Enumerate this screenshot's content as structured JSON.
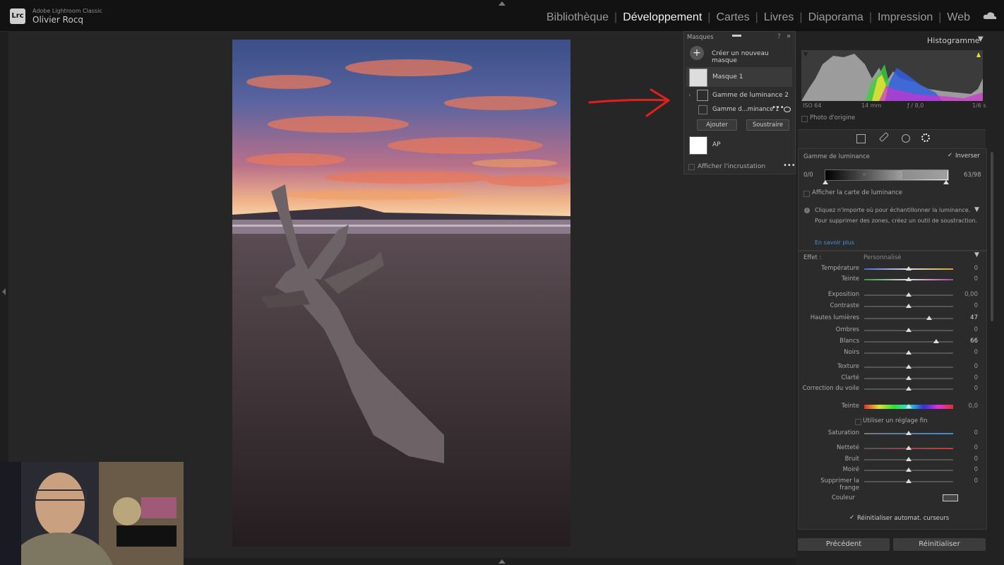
{
  "app": {
    "logo": "Lrc",
    "name": "Adobe Lightroom Classic",
    "user": "Olivier Rocq"
  },
  "modules": [
    "Bibliothèque",
    "Développement",
    "Cartes",
    "Livres",
    "Diaporama",
    "Impression",
    "Web"
  ],
  "active_module": "Développement",
  "masks": {
    "title": "Masques",
    "new_mask": "Créer un nouveau masque",
    "mask1": "Masque 1",
    "lum2": "Gamme de luminance 2",
    "lum1": "Gamme d...minance 1",
    "add": "Ajouter",
    "subtract": "Soustraire",
    "ap": "AP",
    "overlay": "Afficher l'incrustation"
  },
  "histogram": {
    "title": "Histogramme",
    "iso": "ISO 64",
    "focal": "14 mm",
    "aperture": "ƒ / 8,0",
    "shutter": "1/6 s",
    "original": "Photo d'origine"
  },
  "luminance": {
    "title": "Gamme de luminance",
    "invert": "Inverser",
    "left_val": "0/0",
    "right_val": "63/98",
    "show_map": "Afficher la carte de luminance",
    "info1": "Cliquez n'importe où pour échantillonner la luminance.",
    "info2": "Pour supprimer des zones, créez un outil de soustraction.",
    "learn_more": "En savoir plus"
  },
  "effect": {
    "label": "Effet :",
    "preset": "Personnalisé"
  },
  "sliders": [
    {
      "name": "Température",
      "value": "0",
      "pos": 0.5
    },
    {
      "name": "Teinte",
      "value": "0",
      "pos": 0.5
    },
    {
      "name": "Exposition",
      "value": "0,00",
      "pos": 0.5
    },
    {
      "name": "Contraste",
      "value": "0",
      "pos": 0.5
    },
    {
      "name": "Hautes lumières",
      "value": "47",
      "pos": 0.73
    },
    {
      "name": "Ombres",
      "value": "0",
      "pos": 0.5
    },
    {
      "name": "Blancs",
      "value": "66",
      "pos": 0.81
    },
    {
      "name": "Noirs",
      "value": "0",
      "pos": 0.5
    },
    {
      "name": "Texture",
      "value": "0",
      "pos": 0.5
    },
    {
      "name": "Clarté",
      "value": "0",
      "pos": 0.5
    },
    {
      "name": "Correction du voile",
      "value": "0",
      "pos": 0.5
    },
    {
      "name": "Teinte",
      "value": "0,0",
      "pos": 0.5
    },
    {
      "name": "Saturation",
      "value": "0",
      "pos": 0.5
    },
    {
      "name": "Netteté",
      "value": "0",
      "pos": 0.5
    },
    {
      "name": "Bruit",
      "value": "0",
      "pos": 0.5
    },
    {
      "name": "Moiré",
      "value": "0",
      "pos": 0.5
    },
    {
      "name": "Supprimer la frange",
      "value": "0",
      "pos": 0.5
    }
  ],
  "fine_tune": "Utiliser un réglage fin",
  "color_label": "Couleur",
  "auto_reset": "Réinitialiser automat. curseurs",
  "buttons": {
    "previous": "Précédent",
    "reset": "Réinitialiser"
  }
}
